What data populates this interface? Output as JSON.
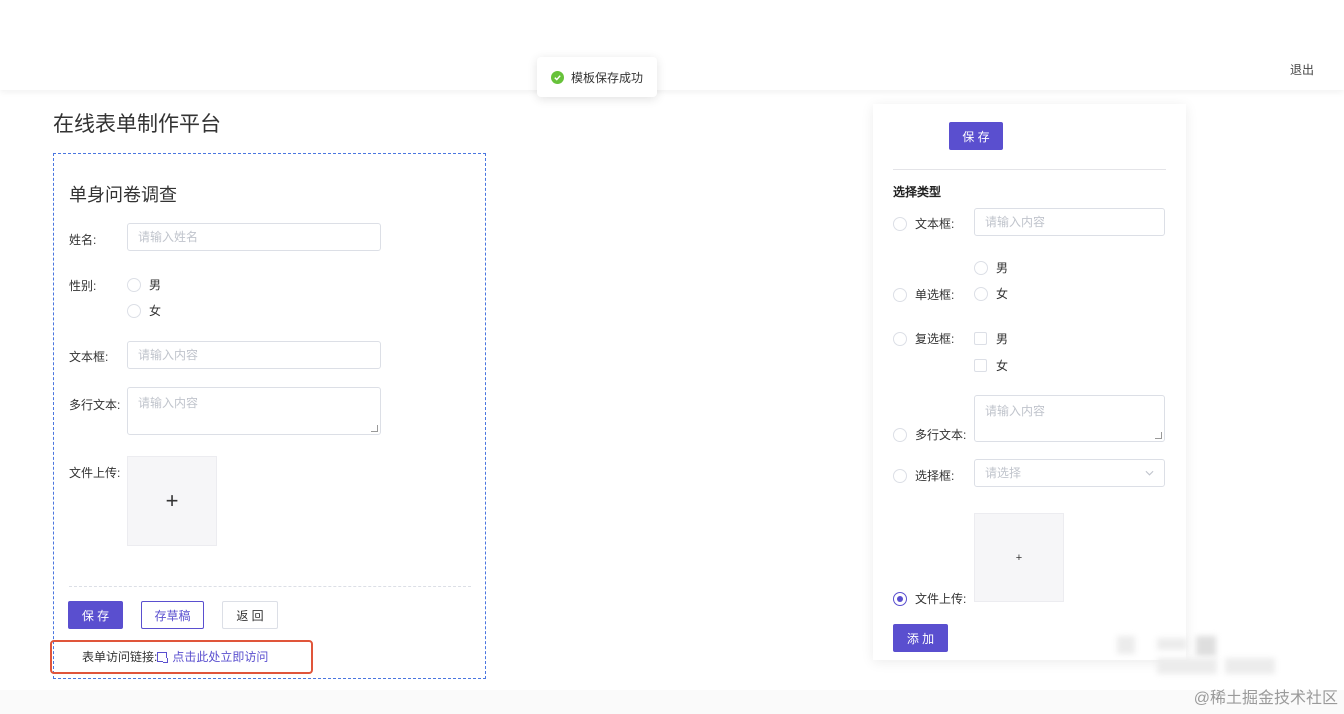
{
  "header": {
    "logout_label": "退出"
  },
  "toast": {
    "message": "模板保存成功",
    "icon": "check-circle-icon"
  },
  "page": {
    "title": "在线表单制作平台"
  },
  "form": {
    "title": "单身问卷调查",
    "fields": {
      "name": {
        "label": "姓名:",
        "placeholder": "请输入姓名"
      },
      "gender": {
        "label": "性别:",
        "options": [
          "男",
          "女"
        ]
      },
      "text": {
        "label": "文本框:",
        "placeholder": "请输入内容"
      },
      "multiline": {
        "label": "多行文本:",
        "placeholder": "请输入内容"
      },
      "upload": {
        "label": "文件上传:",
        "plus": "+"
      }
    },
    "buttons": {
      "save": "保 存",
      "draft": "存草稿",
      "back": "返 回"
    },
    "access": {
      "label": "表单访问链接:",
      "link_text": "点击此处立即访问"
    }
  },
  "panel": {
    "save_button": "保 存",
    "section_title": "选择类型",
    "types": {
      "text": {
        "label": "文本框:",
        "placeholder": "请输入内容"
      },
      "radio": {
        "label": "单选框:",
        "options": [
          "男",
          "女"
        ]
      },
      "checkbox": {
        "label": "复选框:",
        "options": [
          "男",
          "女"
        ]
      },
      "multiline": {
        "label": "多行文本:",
        "placeholder": "请输入内容"
      },
      "select": {
        "label": "选择框:",
        "placeholder": "请选择"
      },
      "upload": {
        "label": "文件上传:",
        "plus": "+"
      }
    },
    "selected_type": "upload",
    "add_button": "添 加"
  },
  "watermark": "@稀土掘金技术社区",
  "colors": {
    "accent": "#5a4fcf",
    "success": "#67c23a",
    "highlight": "#e0553a",
    "form_border": "#4a76e0"
  }
}
